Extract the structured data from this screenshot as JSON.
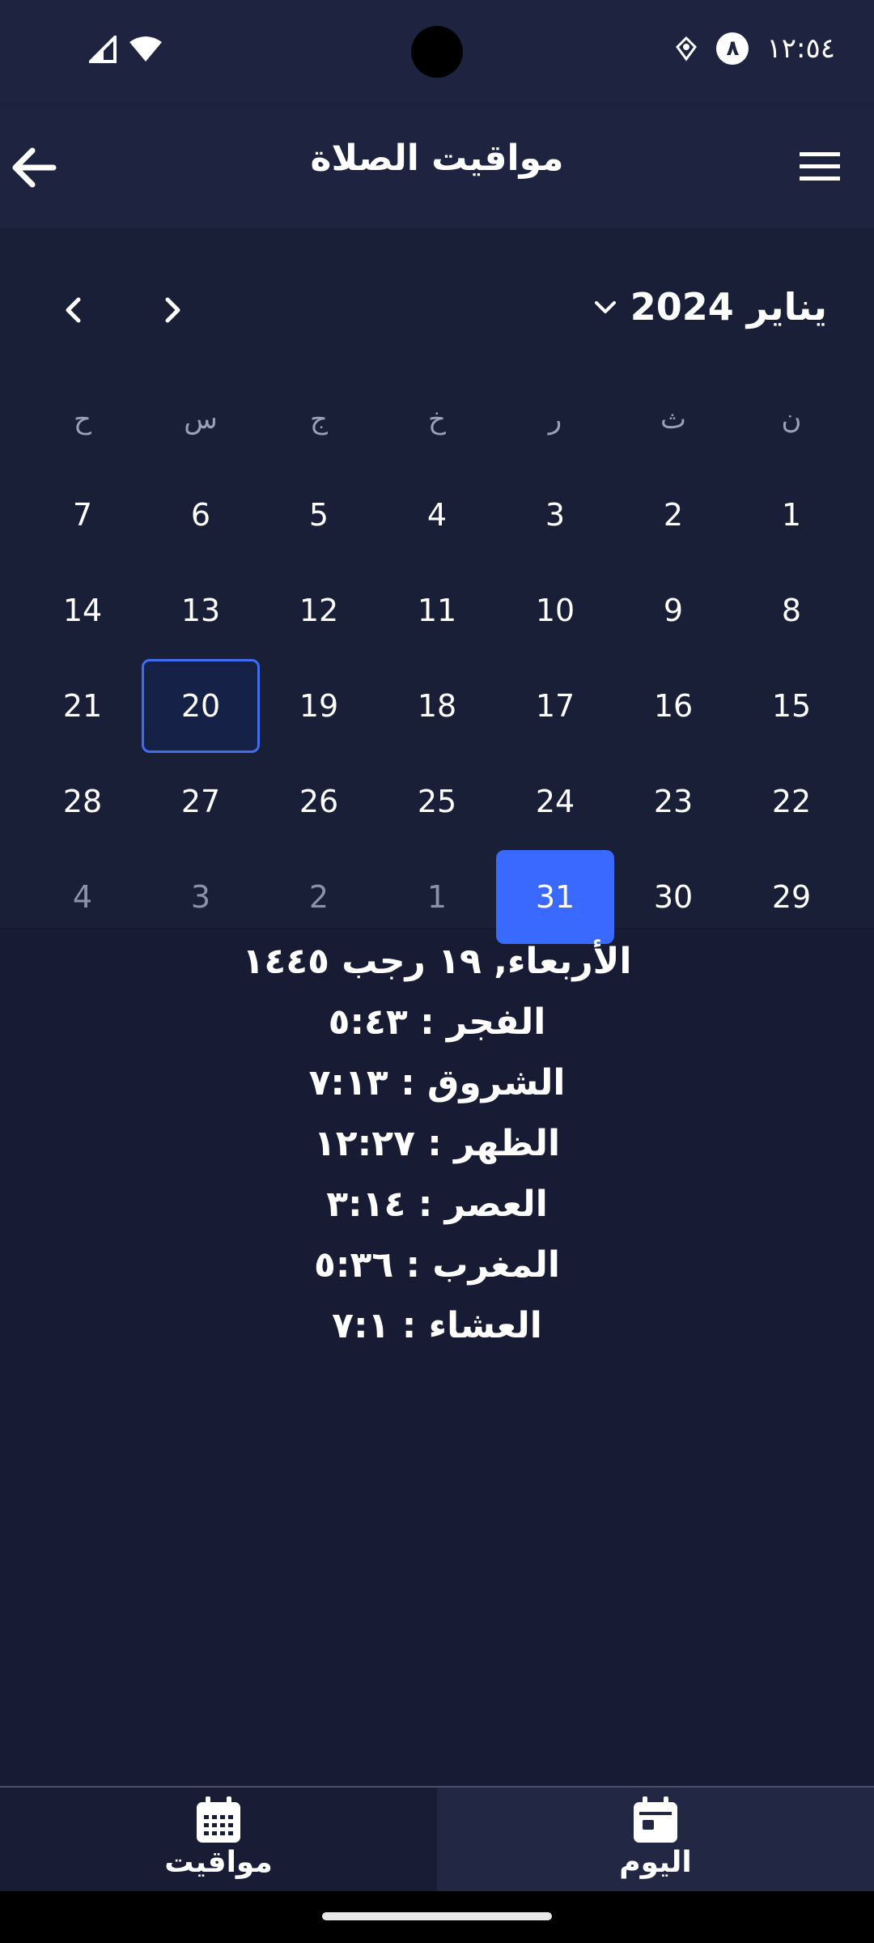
{
  "status_bar": {
    "time": "١٢:٥٤",
    "badge": "٨"
  },
  "app_bar": {
    "title": "مواقيت الصلاة"
  },
  "calendar": {
    "month_label": "يناير 2024",
    "weekdays": [
      "ح",
      "س",
      "ج",
      "خ",
      "ر",
      "ث",
      "ن"
    ],
    "weeks": [
      [
        "7",
        "6",
        "5",
        "4",
        "3",
        "2",
        "1"
      ],
      [
        "14",
        "13",
        "12",
        "11",
        "10",
        "9",
        "8"
      ],
      [
        "21",
        "20",
        "19",
        "18",
        "17",
        "16",
        "15"
      ],
      [
        "28",
        "27",
        "26",
        "25",
        "24",
        "23",
        "22"
      ],
      [
        "4",
        "3",
        "2",
        "1",
        "31",
        "30",
        "29"
      ]
    ],
    "today": "20",
    "selected": "31"
  },
  "prayers": {
    "date": "الأربعاء, ١٩ رجب ١٤٤٥",
    "fajr": "الفجر : ٥:٤٣",
    "sunrise": "الشروق : ٧:١٣",
    "dhuhr": "الظهر : ١٢:٢٧",
    "asr": "العصر : ٣:١٤",
    "maghrib": "المغرب : ٥:٣٦",
    "isha": "العشاء : ٧:١"
  },
  "bottom_nav": {
    "timings_label": "مواقيت",
    "today_label": "اليوم"
  },
  "colors": {
    "background": "#171b33",
    "bar": "#1e2340",
    "accent": "#3a69ff"
  }
}
